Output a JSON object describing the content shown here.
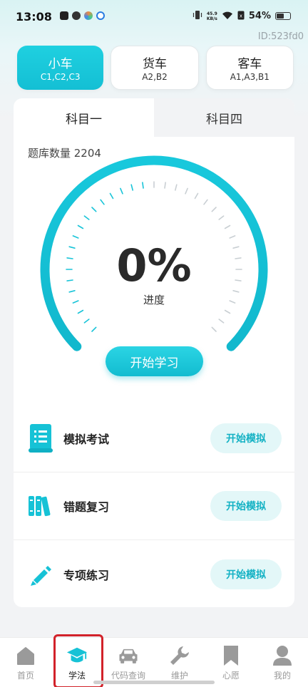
{
  "status_bar": {
    "time": "13:08",
    "net_speed_value": "45.9",
    "net_speed_unit": "KB/s",
    "battery": "54%"
  },
  "user_id": "ID:523fd0",
  "vehicle_tabs": [
    {
      "title": "小车",
      "codes": "C1,C2,C3",
      "active": true
    },
    {
      "title": "货车",
      "codes": "A2,B2",
      "active": false
    },
    {
      "title": "客车",
      "codes": "A1,A3,B1",
      "active": false
    }
  ],
  "subject_tabs": [
    {
      "label": "科目一",
      "active": true
    },
    {
      "label": "科目四",
      "active": false
    }
  ],
  "question_bank": {
    "label": "题库数量 2204",
    "count": 2204
  },
  "progress": {
    "value": "0%",
    "label": "进度",
    "fraction": 0
  },
  "start_study_label": "开始学习",
  "modes": [
    {
      "title": "模拟考试",
      "icon": "exam-scroll-icon",
      "button": "开始模拟"
    },
    {
      "title": "错题复习",
      "icon": "books-icon",
      "button": "开始模拟"
    },
    {
      "title": "专项练习",
      "icon": "pencil-icon",
      "button": "开始模拟"
    }
  ],
  "bottom_nav": [
    {
      "label": "首页",
      "icon": "home-icon",
      "active": false
    },
    {
      "label": "学法",
      "icon": "graduation-cap-icon",
      "active": true
    },
    {
      "label": "代码查询",
      "icon": "car-icon",
      "active": false
    },
    {
      "label": "维护",
      "icon": "wrench-icon",
      "active": false
    },
    {
      "label": "心愿",
      "icon": "bookmark-icon",
      "active": false
    },
    {
      "label": "我的",
      "icon": "user-icon",
      "active": false
    }
  ],
  "colors": {
    "accent": "#14bfd4",
    "accent_light": "#e3f7f8",
    "highlight": "#d2222a"
  }
}
